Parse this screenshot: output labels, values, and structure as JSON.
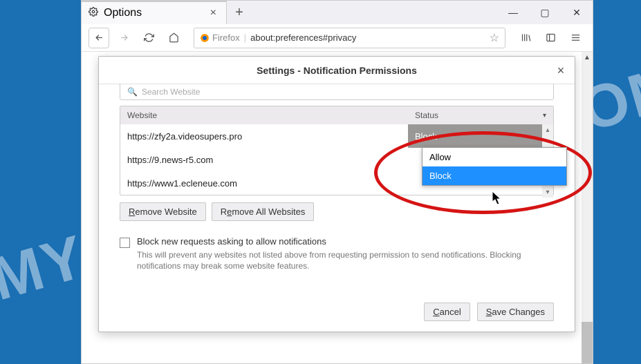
{
  "window": {
    "tab_title": "Options",
    "url_brand": "Firefox",
    "url": "about:preferences#privacy"
  },
  "dialog": {
    "title": "Settings - Notification Permissions",
    "search_placeholder_truncated": "Search Website",
    "columns": {
      "website": "Website",
      "status": "Status"
    },
    "rows": [
      {
        "url": "https://zfy2a.videosupers.pro",
        "status": "Block",
        "selected": true
      },
      {
        "url": "https://9.news-r5.com",
        "status": ""
      },
      {
        "url": "https://www1.ecleneue.com",
        "status": ""
      }
    ],
    "dropdown": {
      "options": [
        "Allow",
        "Block"
      ],
      "highlighted": "Block"
    },
    "buttons": {
      "remove_website": "Remove Website",
      "remove_all": "Remove All Websites",
      "cancel": "Cancel",
      "save": "Save Changes"
    },
    "checkbox": {
      "label": "Block new requests asking to allow notifications",
      "help": "This will prevent any websites not listed above from requesting permission to send notifications. Blocking notifications may break some website features."
    }
  },
  "watermark": "MYANTISPYWARE.COM"
}
